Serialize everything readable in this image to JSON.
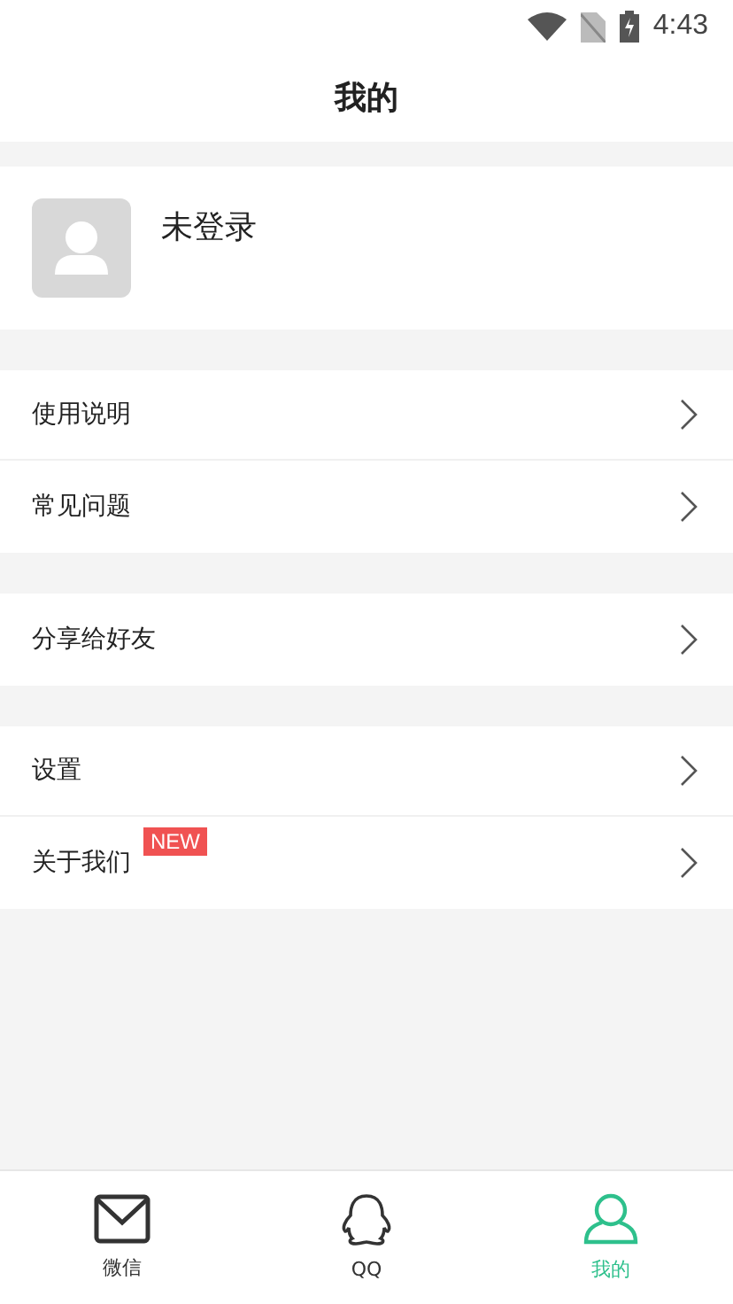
{
  "status_bar": {
    "time": "4:43"
  },
  "header": {
    "title": "我的"
  },
  "profile": {
    "name": "未登录"
  },
  "menu_groups": [
    {
      "items": [
        {
          "label": "使用说明"
        },
        {
          "label": "常见问题"
        }
      ]
    },
    {
      "items": [
        {
          "label": "分享给好友"
        }
      ]
    },
    {
      "items": [
        {
          "label": "设置"
        },
        {
          "label": "关于我们",
          "badge": "NEW"
        }
      ]
    }
  ],
  "tabs": [
    {
      "label": "微信",
      "kind": "mail",
      "selected": false
    },
    {
      "label": "QQ",
      "kind": "penguin",
      "selected": false
    },
    {
      "label": "我的",
      "kind": "person",
      "selected": true
    }
  ]
}
